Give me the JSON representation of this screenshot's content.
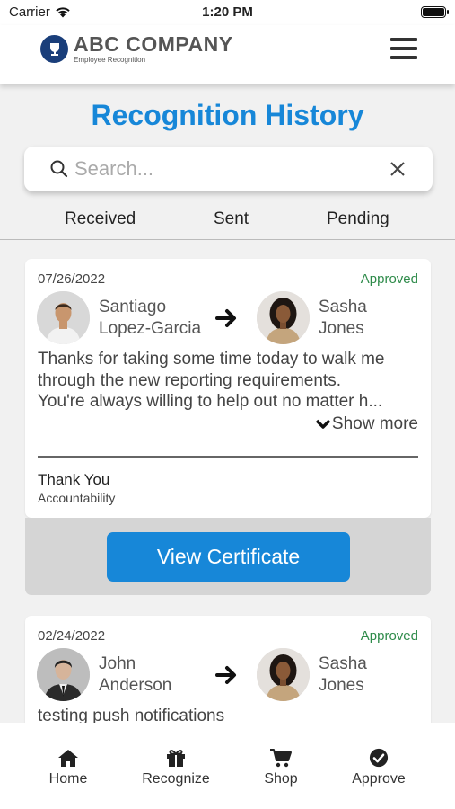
{
  "status_bar": {
    "carrier": "Carrier",
    "time": "1:20 PM"
  },
  "header": {
    "company_name": "ABC COMPANY",
    "company_tagline": "Employee Recognition"
  },
  "page": {
    "title": "Recognition History"
  },
  "search": {
    "placeholder": "Search...",
    "value": ""
  },
  "tabs": [
    {
      "label": "Received",
      "active": true
    },
    {
      "label": "Sent",
      "active": false
    },
    {
      "label": "Pending",
      "active": false
    }
  ],
  "recognitions": [
    {
      "date": "07/26/2022",
      "status": "Approved",
      "sender": {
        "first": "Santiago",
        "last": "Lopez-Garcia"
      },
      "recipient": {
        "first": "Sasha",
        "last": "Jones"
      },
      "message_lines": [
        "Thanks for taking some time today to walk me",
        "through the new reporting requirements.",
        "You're always willing to help out no matter h..."
      ],
      "show_more": "Show more",
      "award_type": "Thank You",
      "award_value": "Accountability",
      "certificate_button": "View Certificate"
    },
    {
      "date": "02/24/2022",
      "status": "Approved",
      "sender": {
        "first": "John",
        "last": "Anderson"
      },
      "recipient": {
        "first": "Sasha",
        "last": "Jones"
      },
      "message_lines": [
        "testing push notifications"
      ]
    }
  ],
  "bottom_nav": [
    {
      "label": "Home",
      "icon": "home-icon"
    },
    {
      "label": "Recognize",
      "icon": "gift-icon"
    },
    {
      "label": "Shop",
      "icon": "cart-icon"
    },
    {
      "label": "Approve",
      "icon": "check-circle-icon"
    }
  ],
  "colors": {
    "accent": "#1787d8",
    "approved": "#2e8b4a",
    "footer_gray": "#d5d5d5"
  }
}
